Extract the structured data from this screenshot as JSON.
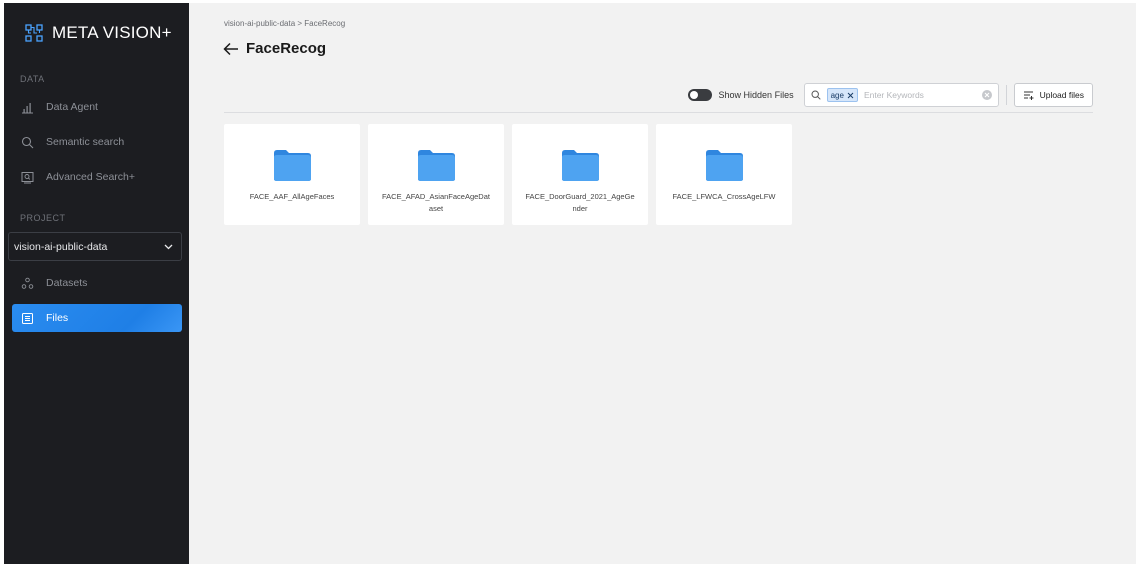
{
  "app": {
    "name": "META VISION+"
  },
  "sidebar": {
    "data_section_label": "DATA",
    "data_items": [
      {
        "label": "Data Agent",
        "icon": "bar-chart-icon"
      },
      {
        "label": "Semantic search",
        "icon": "search-icon"
      },
      {
        "label": "Advanced Search+",
        "icon": "image-search-icon"
      }
    ],
    "project_section_label": "PROJECT",
    "project_select": {
      "value": "vision-ai-public-data"
    },
    "project_items": [
      {
        "label": "Datasets",
        "icon": "datasets-icon",
        "active": false
      },
      {
        "label": "Files",
        "icon": "files-icon",
        "active": true
      }
    ]
  },
  "main": {
    "breadcrumb": "vision-ai-public-data > FaceRecog",
    "title": "FaceRecog",
    "toolbar": {
      "toggle_label": "Show Hidden Files",
      "toggle_on": false,
      "search_chip": "age",
      "search_placeholder": "Enter Keywords",
      "search_value": "",
      "upload_label": "Upload files"
    },
    "folders": [
      {
        "name": "FACE_AAF_AllAgeFaces"
      },
      {
        "name": "FACE_AFAD_AsianFaceAgeDataset"
      },
      {
        "name": "FACE_DoorGuard_2021_AgeGender"
      },
      {
        "name": "FACE_LFWCA_CrossAgeLFW"
      }
    ]
  },
  "colors": {
    "sidebar_bg": "#1c1d21",
    "accent": "#2a8cf0",
    "main_bg": "#f2f2f2",
    "folder": "#3d97ec"
  }
}
